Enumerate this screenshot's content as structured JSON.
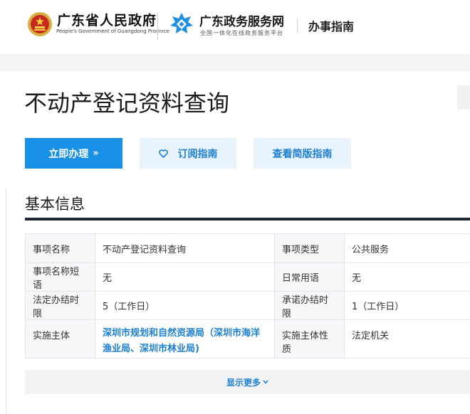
{
  "header": {
    "gov_title": "广东省人民政府",
    "gov_subtitle": "People's Government of Guangdong Province",
    "service_title": "广东政务服务网",
    "service_subtitle": "全国一体化在线政务服务平台",
    "nav_label": "办事指南",
    "colors": {
      "service_logo": "#1f8fe0",
      "gov_emblem": "#c8281e"
    }
  },
  "page": {
    "title": "不动产登记资料查询"
  },
  "actions": {
    "apply_label": "立即办理",
    "apply_icon": "double-chevron-right-icon",
    "subscribe_label": "订阅指南",
    "subscribe_icon": "heart-icon",
    "brief_label": "查看简版指南",
    "colors": {
      "primary": "#1890e6",
      "secondary_bg": "#e8f3fd",
      "secondary_text": "#1c7fd1"
    }
  },
  "basic_info": {
    "section_title": "基本信息",
    "rows": [
      {
        "label1": "事项名称",
        "value1": "不动产登记资料查询",
        "label2": "事项类型",
        "value2": "公共服务"
      },
      {
        "label1": "事项名称短语",
        "value1": "无",
        "label2": "日常用语",
        "value2": "无"
      },
      {
        "label1": "法定办结时限",
        "value1": "5（工作日）",
        "label2": "承诺办结时限",
        "value2": "1（工作日）"
      },
      {
        "label1": "实施主体",
        "value1": "深圳市规划和自然资源局（深圳市海洋渔业局、深圳市林业局)",
        "label2": "实施主体性质",
        "value2": "法定机关"
      }
    ],
    "more_label": "显示更多",
    "more_icon": "chevron-down-icon"
  }
}
